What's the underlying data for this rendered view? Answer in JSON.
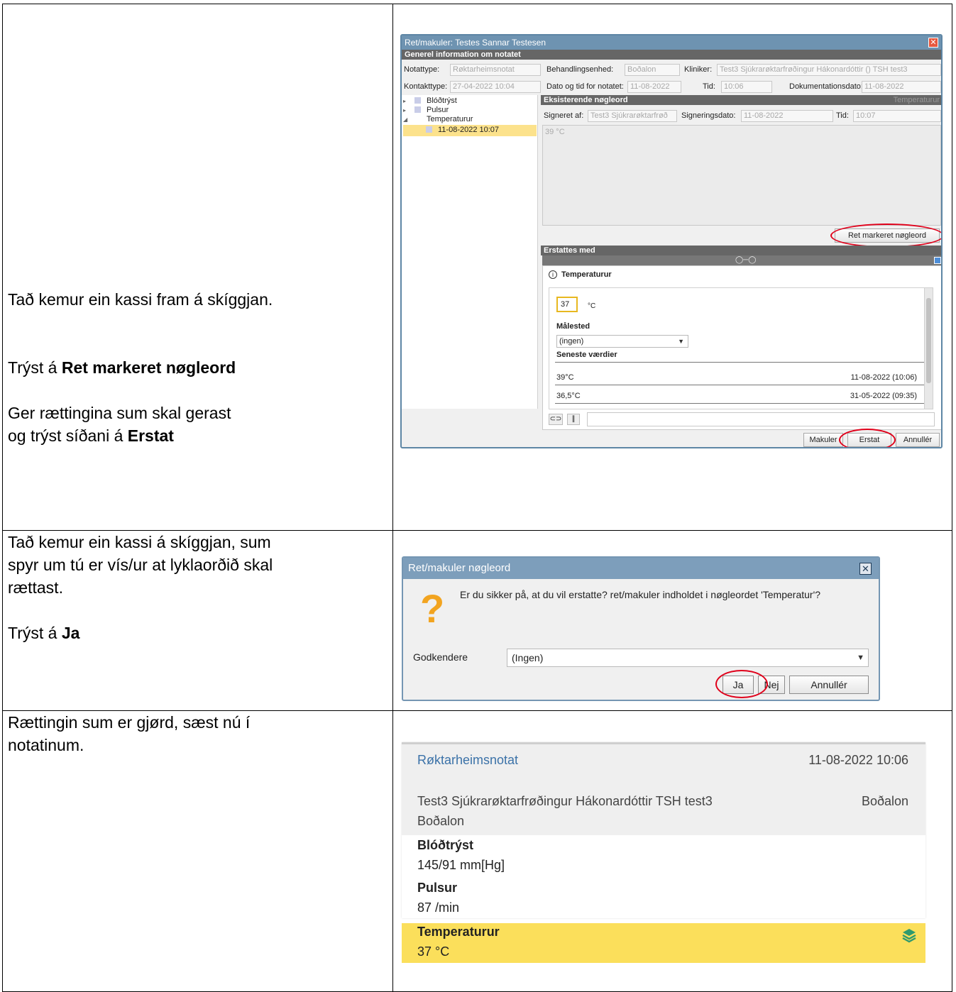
{
  "row1": {
    "instructions": {
      "line1": "Tað kemur ein kassi fram á skíggjan.",
      "line2_prefix": "Trýst á ",
      "line2_bold": "Ret markeret nøgleord",
      "line3": "Ger rættingina sum skal gerast",
      "line4_prefix": "og trýst síðani á ",
      "line4_bold": "Erstat"
    },
    "dialog": {
      "title": "Ret/makuler: Testes Sannar Testesen",
      "close_glyph": "✕",
      "section_general": "Generel information om notatet",
      "notattype_label": "Notattype:",
      "notattype_value": "Røktarheimsnotat",
      "behandlingsenhed_label": "Behandlingsenhed:",
      "behandlingsenhed_value": "Boðalon",
      "kliniker_label": "Kliniker:",
      "kliniker_value": "Test3 Sjúkrarøktarfrøðingur Hákonardóttir () TSH test3",
      "kontakttype_label": "Kontakttype:",
      "kontakttype_value": "27-04-2022 10:04",
      "dato_label": "Dato og tid for notatet:",
      "dato_value": "11-08-2022",
      "tid_label": "Tid:",
      "tid_value": "10:06",
      "dokdato_label": "Dokumentationsdato:",
      "dokdato_value": "11-08-2022",
      "tree": [
        "Blóðtrýst",
        "Pulsur",
        "Temperaturur",
        "11-08-2022 10:07"
      ],
      "section_existing": "Eksisterende nøgleord",
      "section_existing_right": "Temperaturur",
      "signeret_label": "Signeret af:",
      "signeret_value": "Test3 Sjúkrarøktarfrøð",
      "signdato_label": "Signeringsdato:",
      "signdato_value": "11-08-2022",
      "signtid_label": "Tid:",
      "signtid_value": "10:07",
      "existing_text": "39 °C",
      "ret_button": "Ret markeret nøgleord",
      "section_replace": "Erstattes med",
      "info_icon": "i",
      "keyword_title": "Temperaturur",
      "temp_input": "37",
      "temp_unit": "°C",
      "malested_label": "Målested",
      "malested_value": "(ingen)",
      "seneste_label": "Seneste værdier",
      "history": [
        {
          "value": "39°C",
          "date": "11-08-2022 (10:06)"
        },
        {
          "value": "36,5°C",
          "date": "31-05-2022 (09:35)"
        }
      ],
      "btn_makuler": "Makuler",
      "btn_erstat": "Erstat",
      "btn_annuller": "Annullér"
    }
  },
  "row2": {
    "instructions": {
      "line1": "Tað kemur ein kassi á skíggjan, sum",
      "line2": "spyr um tú er vís/ur at lyklaorðið skal",
      "line3": "rættast.",
      "line4_prefix": "Trýst á ",
      "line4_bold": "Ja"
    },
    "dialog": {
      "title": "Ret/makuler nøgleord",
      "close_glyph": "✕",
      "question": "Er du sikker på, at du vil erstatte? ret/makuler indholdet i nøgleordet 'Temperatur'?",
      "godkendere_label": "Godkendere",
      "godkendere_value": "(Ingen)",
      "btn_ja": "Ja",
      "btn_nej": "Nej",
      "btn_annuller": "Annullér"
    }
  },
  "row3": {
    "instructions": {
      "line1": "Rættingin sum er gjørd, sæst nú í",
      "line2": "notatinum."
    },
    "note": {
      "type": "Røktarheimsnotat",
      "datetime": "11-08-2022 10:06",
      "clinician": "Test3 Sjúkrarøktarfrøðingur Hákonardóttir  TSH test3",
      "unit_right": "Boðalon",
      "unit_left": "Boðalon",
      "items": [
        {
          "keyword": "Blóðtrýst",
          "value": "145/91 mm[Hg]"
        },
        {
          "keyword": "Pulsur",
          "value": "87 /min"
        },
        {
          "keyword": "Temperaturur",
          "value": "37 °C"
        }
      ],
      "highlight_color": "#fbdf5b"
    }
  }
}
